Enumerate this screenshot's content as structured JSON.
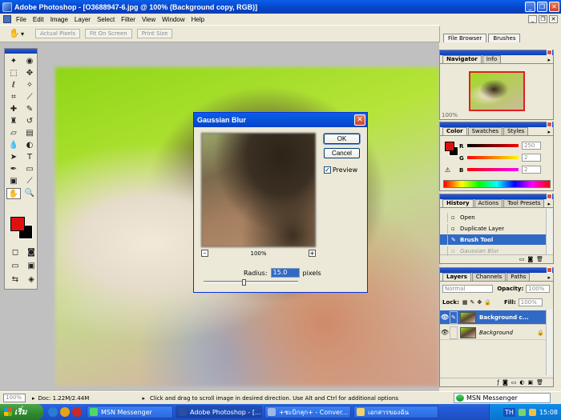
{
  "window": {
    "title": "Adobe Photoshop - [O3688947-6.jpg @ 100% (Background copy, RGB)]"
  },
  "menu": [
    "File",
    "Edit",
    "Image",
    "Layer",
    "Select",
    "Filter",
    "View",
    "Window",
    "Help"
  ],
  "options_bar": {
    "actual_pixels": "Actual Pixels",
    "fit_on_screen": "Fit On Screen",
    "print_size": "Print Size",
    "dropdown_arrow": "▾"
  },
  "palette_well": {
    "file_browser": "File Browser",
    "brushes": "Brushes"
  },
  "dialog": {
    "title": "Gaussian Blur",
    "ok": "OK",
    "cancel": "Cancel",
    "preview_label": "Preview",
    "preview_checked": true,
    "zoom": "100%",
    "zoom_minus": "–",
    "zoom_plus": "+",
    "radius_label": "Radius:",
    "radius_value": "15.0",
    "radius_units": "pixels",
    "radius_slider_fraction": 0.42
  },
  "navigator": {
    "tabs": [
      "Navigator",
      "Info"
    ],
    "zoom": "100%"
  },
  "color": {
    "tabs": [
      "Color",
      "Swatches",
      "Styles"
    ],
    "channels": [
      {
        "label": "R",
        "value": "250"
      },
      {
        "label": "G",
        "value": "2"
      },
      {
        "label": "B",
        "value": "2"
      }
    ]
  },
  "history": {
    "tabs": [
      "History",
      "Actions",
      "Tool Presets"
    ],
    "items": [
      "Open",
      "Duplicate Layer",
      "Brush Tool",
      "Gaussian Blur"
    ],
    "selected_index": 2
  },
  "layers": {
    "tabs": [
      "Layers",
      "Channels",
      "Paths"
    ],
    "blend_mode": "Normal",
    "opacity_label": "Opacity:",
    "opacity": "100%",
    "lock_label": "Lock:",
    "fill_label": "Fill:",
    "fill": "100%",
    "items": [
      {
        "name": "Background c...",
        "selected": true
      },
      {
        "name": "Background",
        "selected": false
      }
    ]
  },
  "status": {
    "zoom": "100%",
    "doc": "Doc: 1.22M/2.44M",
    "tip": "Click and drag to scroll image in desired direction.  Use Alt and Ctrl for additional options",
    "msn": "MSN Messenger"
  },
  "taskbar": {
    "start": "เริ่ม",
    "tasks": [
      {
        "label": "MSN Messenger",
        "active": false
      },
      {
        "label": "Adobe Photoshop - [...",
        "active": true
      },
      {
        "label": "+ชะบิกลุก+ - Conver...",
        "active": false
      },
      {
        "label": "เอกสารของฉัน",
        "active": false
      }
    ],
    "lang": "TH",
    "time": "15:08"
  },
  "colors": {
    "foreground": "#e01010",
    "background": "#000000",
    "accent": "#0a5fe8"
  }
}
